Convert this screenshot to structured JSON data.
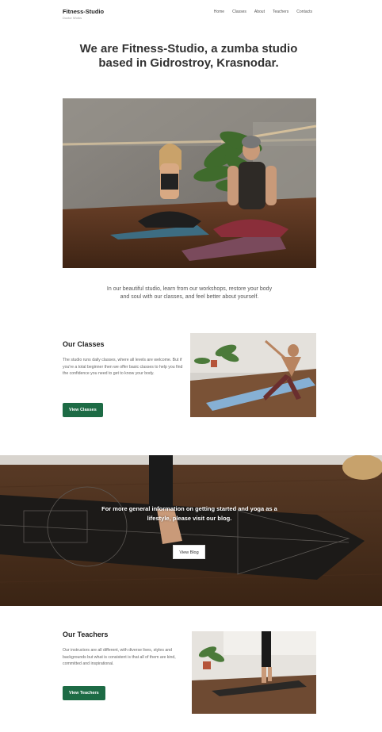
{
  "brand": {
    "name": "Fitness-Studio",
    "subtitle": "Doctor Works"
  },
  "nav": {
    "items": [
      "Home",
      "Classes",
      "About",
      "Teachers",
      "Contacts"
    ]
  },
  "hero": {
    "title": "We are Fitness-Studio, a zumba studio based in Gidrostroy, Krasnodar.",
    "intro": "In our beautiful studio, learn from our workshops, restore your body and soul with our classes, and feel better about yourself."
  },
  "classes": {
    "title": "Our Classes",
    "text": "The studio runs daily classes, where all levels are welcome. But if you're a total beginner then we offer basic classes to help you find the confidence you need to get to know your body.",
    "button": "View Classes"
  },
  "blog": {
    "text": "For more general information on getting started and yoga as a lifestyle, please visit our blog.",
    "button": "View Blog"
  },
  "teachers": {
    "title": "Our Teachers",
    "text": "Our instructors are all different, with diverse lives, styles and backgrounds but what is consistent is that all of them are kind, committed and inspirational.",
    "button": "View Teachers"
  },
  "colors": {
    "accent": "#1d6b45",
    "text": "#333333"
  }
}
